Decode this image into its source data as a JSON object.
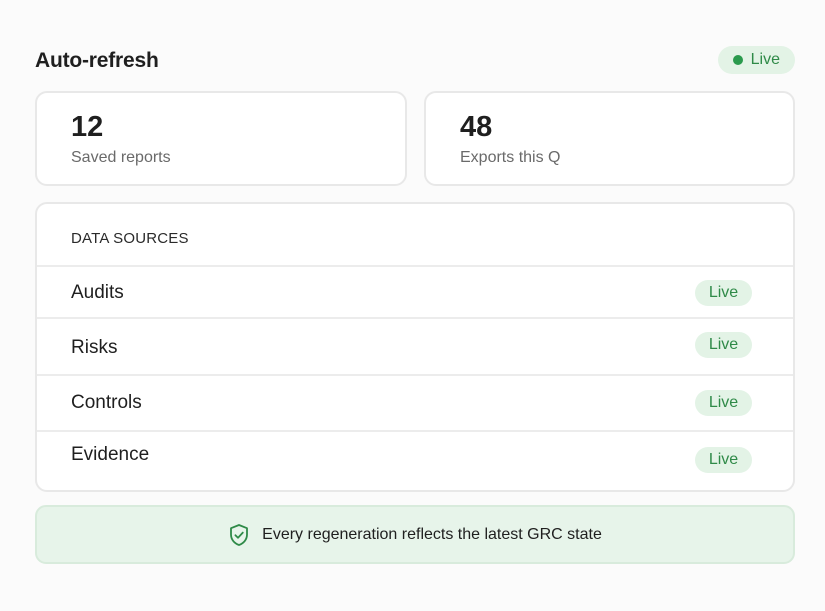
{
  "header": {
    "title": "Auto-refresh",
    "status_label": "Live",
    "status_color": "#2a9a4d"
  },
  "stats": [
    {
      "value": "12",
      "label": "Saved reports"
    },
    {
      "value": "48",
      "label": "Exports this Q"
    }
  ],
  "sources": {
    "heading": "DATA SOURCES",
    "items": [
      {
        "name": "Audits",
        "status": "Live"
      },
      {
        "name": "Risks",
        "status": "Live"
      },
      {
        "name": "Controls",
        "status": "Live"
      },
      {
        "name": "Evidence",
        "status": "Live"
      }
    ]
  },
  "banner": {
    "icon": "shield-check-icon",
    "text": "Every regeneration reflects the latest GRC state"
  },
  "colors": {
    "accent_green": "#2f8a48",
    "badge_bg": "#e3f3e6",
    "banner_bg": "#e7f4ea"
  }
}
